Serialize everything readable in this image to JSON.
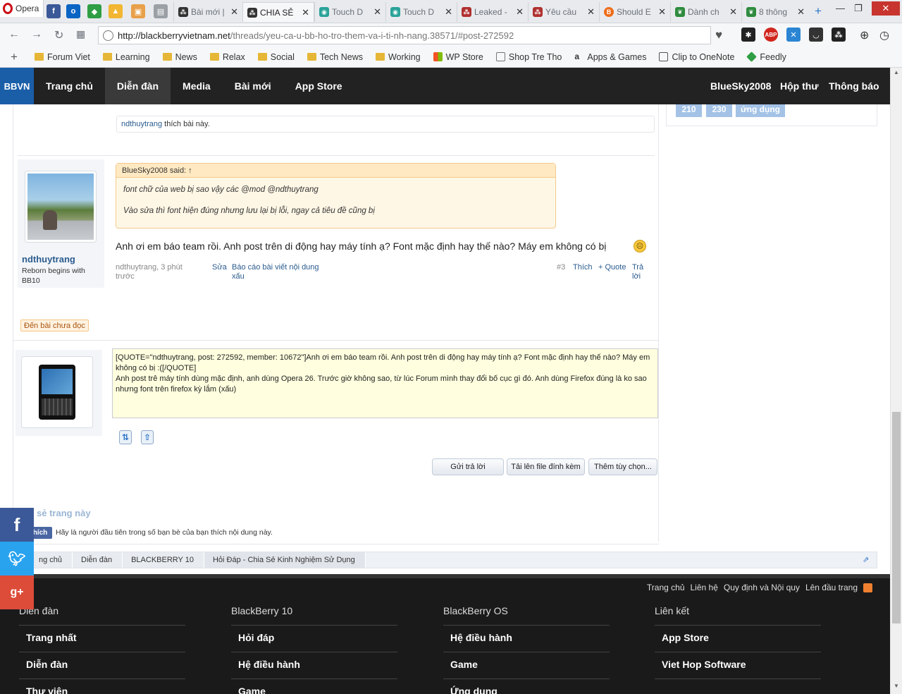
{
  "browser": {
    "opera_label": "Opera",
    "tabs": [
      {
        "title": "Bài mới |",
        "icon_color": "#d13b3b",
        "icon": "bb-icon"
      },
      {
        "title": "CHIA SẺ",
        "icon_color": "#333333",
        "icon": "bb-icon",
        "active": true
      },
      {
        "title": "Touch D",
        "icon_color": "#2aa39a",
        "icon": "touch-icon"
      },
      {
        "title": "Touch D",
        "icon_color": "#2aa39a",
        "icon": "touch-icon"
      },
      {
        "title": "Leaked -",
        "icon_color": "#b03030",
        "icon": "bb-icon"
      },
      {
        "title": "Yêu cầu",
        "icon_color": "#b03030",
        "icon": "bb-icon"
      },
      {
        "title": "Should E",
        "icon_color": "#ef6c1a",
        "icon": "bb-icon"
      },
      {
        "title": "Dành ch",
        "icon_color": "#2f8b3f",
        "icon": "leaf-icon"
      },
      {
        "title": "8 thông",
        "icon_color": "#2f8b3f",
        "icon": "leaf-icon"
      }
    ],
    "url_host": "http://blackberryvietnam.net",
    "url_path": "/threads/yeu-ca-u-bb-ho-tro-them-va-i-ti-nh-nang.38571/#post-272592",
    "bookmarks": [
      {
        "label": "Forum Viet",
        "type": "folder"
      },
      {
        "label": "Learning",
        "type": "folder"
      },
      {
        "label": "News",
        "type": "folder"
      },
      {
        "label": "Relax",
        "type": "folder"
      },
      {
        "label": "Social",
        "type": "folder"
      },
      {
        "label": "Tech News",
        "type": "folder"
      },
      {
        "label": "Working",
        "type": "folder"
      },
      {
        "label": "WP Store",
        "type": "app"
      },
      {
        "label": "Shop Tre Tho",
        "type": "app"
      },
      {
        "label": "Apps & Games",
        "type": "app"
      },
      {
        "label": "Clip to OneNote",
        "type": "app"
      },
      {
        "label": "Feedly",
        "type": "app"
      }
    ]
  },
  "site": {
    "logo": "BBVN",
    "nav": [
      "Trang chủ",
      "Diễn đàn",
      "Media",
      "Bài mới",
      "App Store"
    ],
    "nav_right": [
      "BlueSky2008",
      "Hộp thư",
      "Thông báo"
    ],
    "sidebar_tiles": [
      "210",
      "230",
      "ứng dụng"
    ]
  },
  "post": {
    "likes_user": "ndthuytrang",
    "likes_text": " thích bài này.",
    "quote_author": "BlueSky2008 said: ↑",
    "quote_line1": "font chữ của web bị sao vậy các @mod @ndthuytrang",
    "quote_line2": "Vào sửa thì font hiện đúng nhưng lưu lại bị lỗi, ngay cả tiêu đề cũng bị",
    "message": "Anh ơi em báo team rồi. Anh post trên di động hay máy tính ạ? Font mặc định hay thế nào? Máy em không có bị",
    "poster_name": "ndthuytrang",
    "poster_title": "Reborn begins with BB10",
    "meta_author": "ndthuytrang, 3 phút trước",
    "meta_edit": "Sửa",
    "meta_report": "Báo cáo bài viết nội dung xấu",
    "meta_num": "#3",
    "meta_like": "Thích",
    "meta_quote": "+ Quote",
    "meta_reply": "Trả lời"
  },
  "unread_badge": "Đến bài chưa đọc",
  "reply": {
    "text": "[QUOTE=\"ndthuytrang, post: 272592, member: 10672\"]Anh ơi em báo team rồi. Anh post trên di động hay máy tính ạ? Font mặc định hay thế nào? Máy em không có bị :([/QUOTE]\nAnh post trê máy tính dùng mặc định, anh dùng Opera 26. Trước giờ không sao, từ lúc Forum mình thay đổi bố cục gì đó. Anh dùng Firefox đúng là ko sao nhưng font trên firefox kỳ lắm (xấu)",
    "submit": "Gửi trả lời",
    "upload": "Tải lên file đính kèm",
    "more": "Thêm tùy chọn..."
  },
  "share": {
    "title": "sẻ trang này",
    "like_btn": "hích",
    "like_text": "Hãy là người đầu tiên trong số bạn bè của bạn thích nội dung này."
  },
  "breadcrumb": [
    "ng chủ",
    "Diễn đàn",
    "BLACKBERRY 10",
    "Hỏi Đáp - Chia Sẻ Kinh Nghiệm Sử Dụng"
  ],
  "footer": {
    "links": [
      "Trang chủ",
      "Liên hệ",
      "Quy định và Nội quy",
      "Lên đầu trang"
    ],
    "columns": [
      {
        "title": "Diễn đàn",
        "items": [
          "Trang nhất",
          "Diễn đàn",
          "Thư viện"
        ]
      },
      {
        "title": "BlackBerry 10",
        "items": [
          "Hỏi đáp",
          "Hệ điều hành",
          "Game"
        ]
      },
      {
        "title": "BlackBerry OS",
        "items": [
          "Hệ điều hành",
          "Game",
          "Ứng dụng"
        ]
      },
      {
        "title": "Liên kết",
        "items": [
          "App Store",
          "Viet Hop Software"
        ]
      }
    ]
  },
  "colors": {
    "site_nav_bg": "#222222",
    "link_blue": "#2a5b8f",
    "quote_bg": "#fff7e6",
    "editor_bg": "#ffffdf",
    "facebook": "#3b5998",
    "twitter": "#2aa3ef",
    "google_plus": "#dd4b39"
  }
}
